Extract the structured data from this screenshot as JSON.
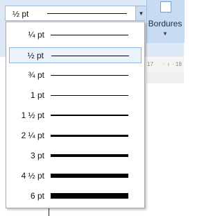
{
  "ribbon": {
    "borders_label": "Bordures",
    "ruler": {
      "mark1": "17",
      "mark2": "· ı ·",
      "mark3": "18"
    }
  },
  "line_weight": {
    "current_value": "½ pt",
    "options": [
      {
        "label": "¼ pt",
        "weight_pt": 0.25
      },
      {
        "label": "½ pt",
        "weight_pt": 0.5,
        "selected": true
      },
      {
        "label": "¾ pt",
        "weight_pt": 0.75
      },
      {
        "label": "1 pt",
        "weight_pt": 1
      },
      {
        "label": "1 ½ pt",
        "weight_pt": 1.5
      },
      {
        "label": "2 ¼ pt",
        "weight_pt": 2.25
      },
      {
        "label": "3 pt",
        "weight_pt": 3
      },
      {
        "label": "4 ½ pt",
        "weight_pt": 4.5
      },
      {
        "label": "6 pt",
        "weight_pt": 6
      }
    ]
  },
  "colors": {
    "selection_bg": "#eaf2fc",
    "selection_border": "#8db3e2",
    "ribbon_bg": "#dde9f7"
  }
}
